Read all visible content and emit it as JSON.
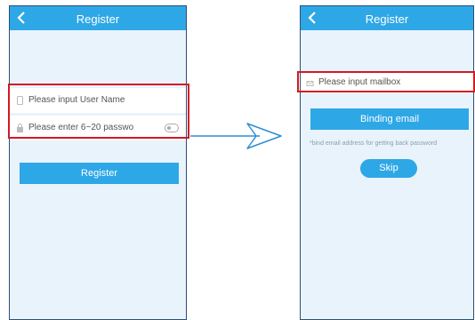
{
  "left_screen": {
    "title": "Register",
    "username_placeholder": "Please input User Name",
    "password_placeholder": "Please enter 6~20 passwo",
    "register_button": "Register"
  },
  "right_screen": {
    "title": "Register",
    "mailbox_placeholder": "Please input mailbox",
    "binding_button": "Binding email",
    "hint": "*bind email address for getting back password",
    "skip_button": "Skip"
  },
  "colors": {
    "accent": "#2ea7e6",
    "highlight": "#d11a25",
    "background": "#e9f3fb"
  },
  "icons": [
    "back-arrow-icon",
    "phone-icon",
    "lock-icon",
    "mail-icon",
    "eye-toggle-icon",
    "right-arrow-icon"
  ]
}
